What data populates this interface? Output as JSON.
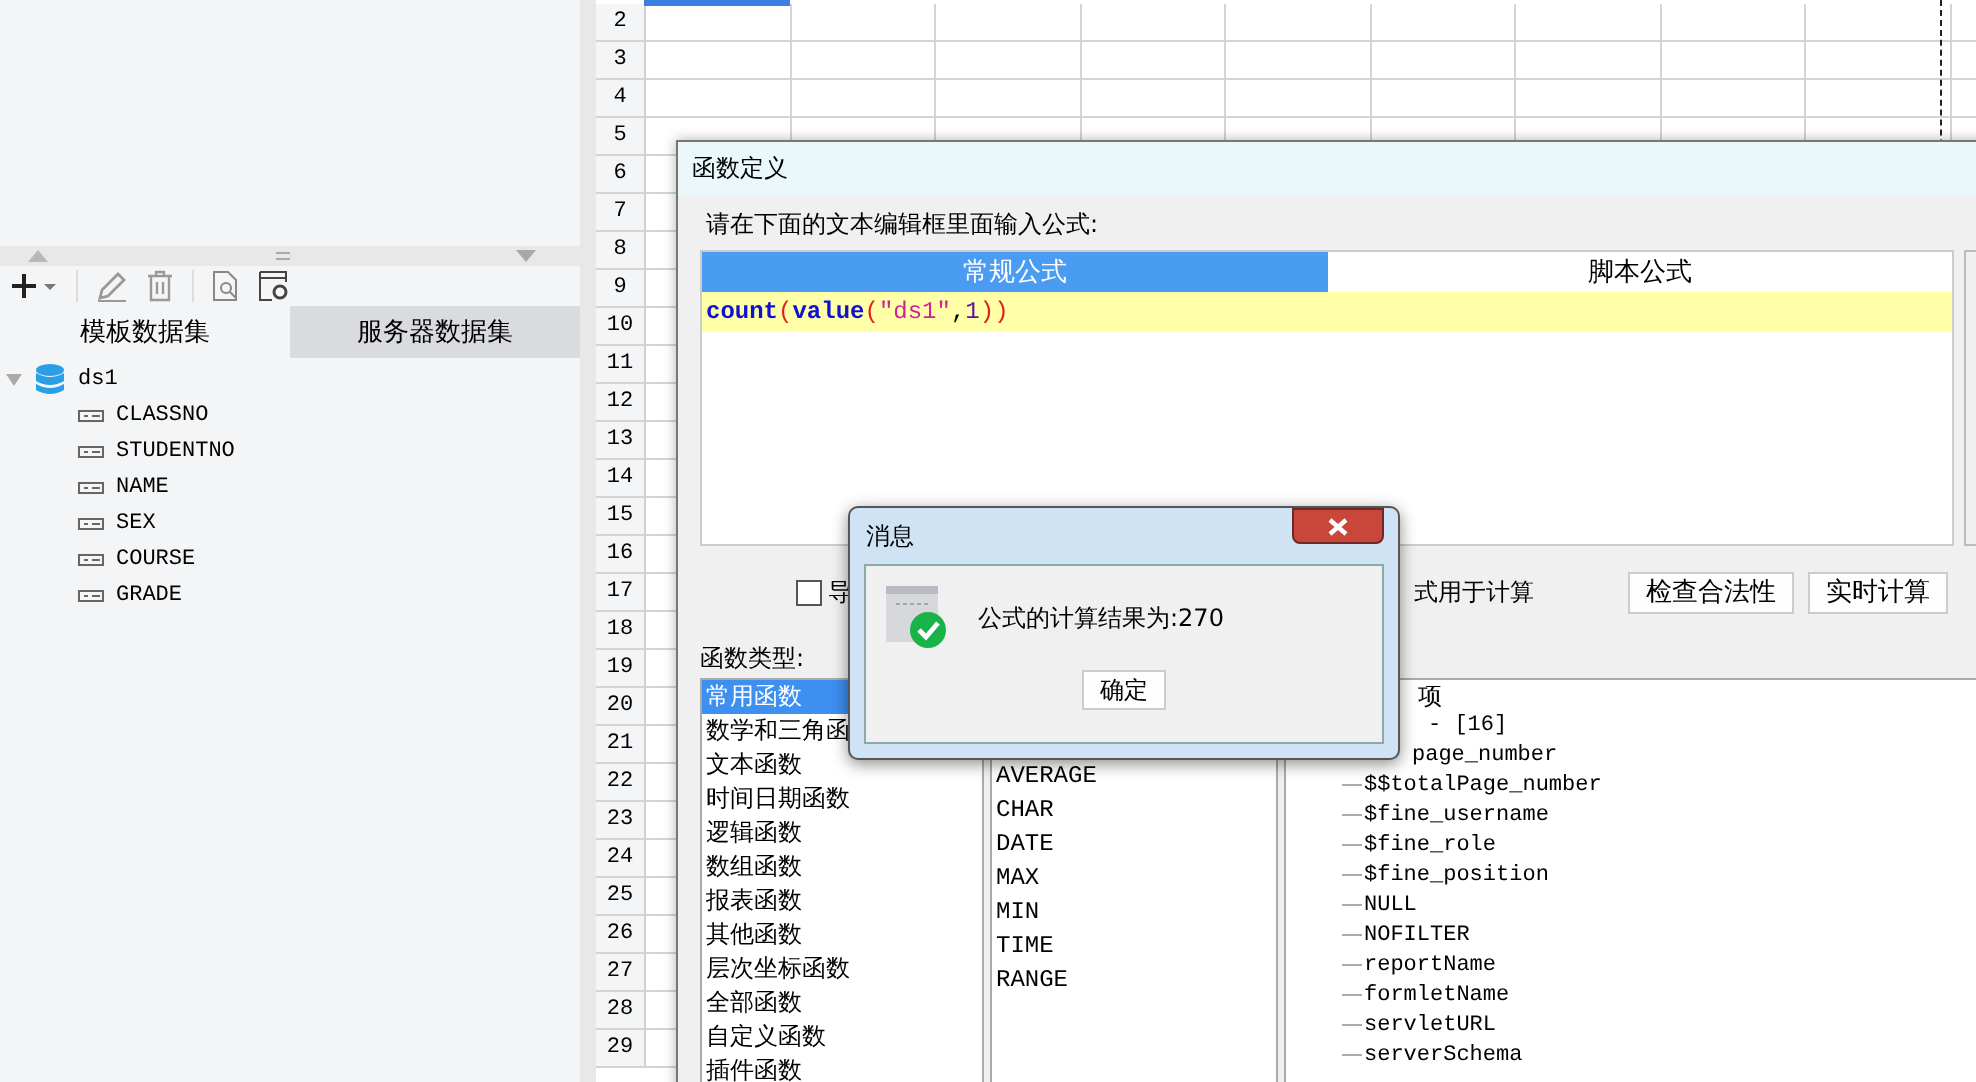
{
  "data_panel": {
    "tabs": [
      {
        "label": "模板数据集",
        "selected": true
      },
      {
        "label": "服务器数据集",
        "selected": false
      }
    ],
    "tree": [
      {
        "label": "ds1",
        "expanded": true,
        "children": [
          {
            "label": "CLASSNO"
          },
          {
            "label": "STUDENTNO"
          },
          {
            "label": "NAME"
          },
          {
            "label": "SEX"
          },
          {
            "label": "COURSE"
          },
          {
            "label": "GRADE"
          }
        ]
      }
    ]
  },
  "sheet": {
    "row_numbers": [
      "2",
      "3",
      "4",
      "5",
      "6",
      "7",
      "8",
      "9",
      "10",
      "11",
      "12",
      "13",
      "14",
      "15",
      "16",
      "17",
      "18",
      "19",
      "20",
      "21",
      "22",
      "23",
      "24",
      "25",
      "26",
      "27",
      "28",
      "29"
    ]
  },
  "formula_dialog": {
    "title": "函数定义",
    "prompt": "请在下面的文本编辑框里面输入公式:",
    "tabs": [
      {
        "label": "常规公式",
        "selected": true
      },
      {
        "label": "脚本公式",
        "selected": false
      }
    ],
    "formula": [
      {
        "kind": "function",
        "text": "count"
      },
      {
        "kind": "paren",
        "text": "("
      },
      {
        "kind": "function",
        "text": "value"
      },
      {
        "kind": "paren",
        "text": "("
      },
      {
        "kind": "string",
        "text": "\"ds1\""
      },
      {
        "kind": "plain",
        "text": ","
      },
      {
        "kind": "number",
        "text": "1"
      },
      {
        "kind": "paren",
        "text": ")"
      },
      {
        "kind": "paren",
        "text": ")"
      }
    ],
    "option": {
      "checked": false,
      "label_start": "导",
      "label_end": "式用于计算"
    },
    "buttons": [
      "检查合法性",
      "实时计算"
    ],
    "function_types_label": "函数类型:",
    "function_types": [
      {
        "label": "常用函数",
        "selected": true
      },
      {
        "label": "数学和三角函",
        "selected": false
      },
      {
        "label": "文本函数",
        "selected": false
      },
      {
        "label": "时间日期函数",
        "selected": false
      },
      {
        "label": "逻辑函数",
        "selected": false
      },
      {
        "label": "数组函数",
        "selected": false
      },
      {
        "label": "报表函数",
        "selected": false
      },
      {
        "label": "其他函数",
        "selected": false
      },
      {
        "label": "层次坐标函数",
        "selected": false
      },
      {
        "label": "全部函数",
        "selected": false
      },
      {
        "label": "自定义函数",
        "selected": false
      },
      {
        "label": "插件函数",
        "selected": false
      }
    ],
    "functions": [
      "AVERAGE",
      "CHAR",
      "DATE",
      "MAX",
      "MIN",
      "TIME",
      "RANGE"
    ],
    "parameters": {
      "header": "项",
      "items": [
        {
          "kind": "group",
          "text": "- [16]"
        },
        {
          "kind": "partial",
          "text": "page_number"
        },
        {
          "kind": "leaf",
          "text": "$$totalPage_number"
        },
        {
          "kind": "leaf",
          "text": "$fine_username"
        },
        {
          "kind": "leaf",
          "text": "$fine_role"
        },
        {
          "kind": "leaf",
          "text": "$fine_position"
        },
        {
          "kind": "leaf",
          "text": "NULL"
        },
        {
          "kind": "leaf",
          "text": "NOFILTER"
        },
        {
          "kind": "leaf",
          "text": "reportName"
        },
        {
          "kind": "leaf",
          "text": "formletName"
        },
        {
          "kind": "leaf",
          "text": "servletURL"
        },
        {
          "kind": "leaf",
          "text": "serverSchema"
        }
      ]
    }
  },
  "message_dialog": {
    "title": "消息",
    "text": "公式的计算结果为:270",
    "button": "确定"
  }
}
